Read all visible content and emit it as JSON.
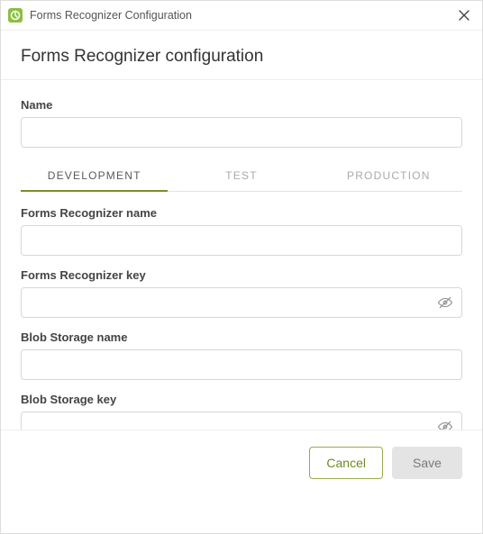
{
  "titlebar": {
    "title": "Forms Recognizer Configuration"
  },
  "header": {
    "title": "Forms Recognizer configuration"
  },
  "form": {
    "name": {
      "label": "Name",
      "value": ""
    }
  },
  "tabs": [
    {
      "label": "DEVELOPMENT",
      "active": true
    },
    {
      "label": "TEST",
      "active": false
    },
    {
      "label": "PRODUCTION",
      "active": false
    }
  ],
  "tabFields": {
    "recognizerName": {
      "label": "Forms Recognizer name",
      "value": ""
    },
    "recognizerKey": {
      "label": "Forms Recognizer key",
      "value": ""
    },
    "blobName": {
      "label": "Blob Storage name",
      "value": ""
    },
    "blobKey": {
      "label": "Blob Storage key",
      "value": ""
    }
  },
  "footer": {
    "cancel": "Cancel",
    "save": "Save"
  }
}
